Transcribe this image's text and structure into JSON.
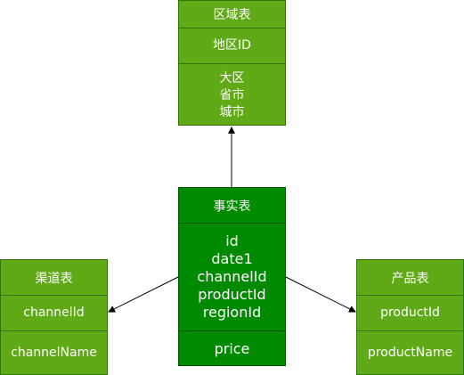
{
  "diagram": {
    "region_table": {
      "title": "区域表",
      "key_field": "地区ID",
      "attributes": [
        "大区",
        "省市",
        "城市"
      ]
    },
    "fact_table": {
      "title": "事实表",
      "keys": [
        "id",
        "date1",
        "channelId",
        "productId",
        "regionId"
      ],
      "measure": "price"
    },
    "channel_table": {
      "title": "渠道表",
      "key_field": "channelId",
      "name_field": "channelName"
    },
    "product_table": {
      "title": "产品表",
      "key_field": "productId",
      "name_field": "productName"
    },
    "colors": {
      "dimension_fill": "#60A917",
      "dimension_stroke": "#2D7600",
      "fact_fill": "#008A00",
      "fact_stroke": "#005700",
      "arrow": "#000000"
    }
  }
}
